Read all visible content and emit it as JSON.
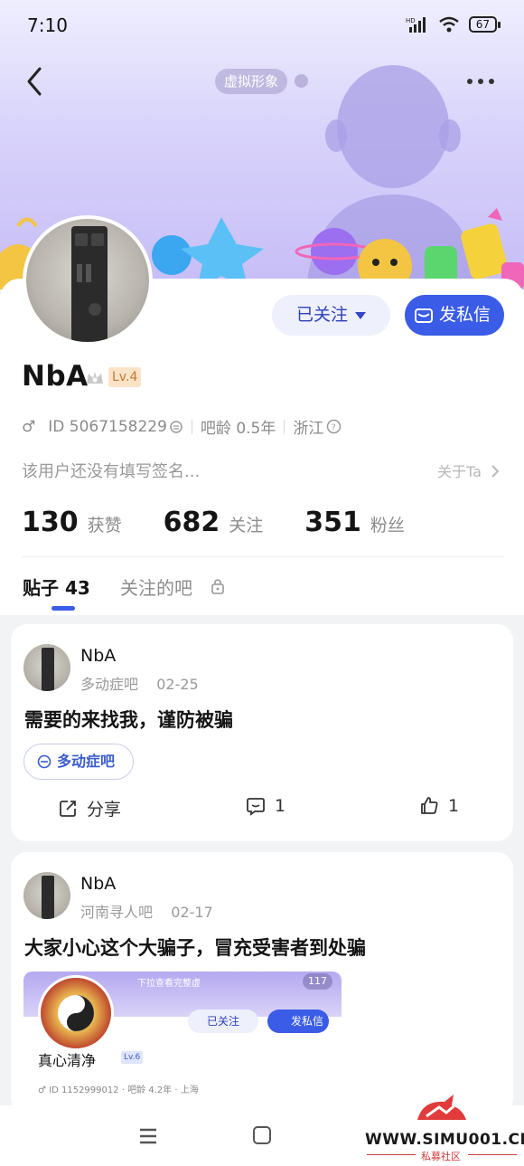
{
  "status_bar": {
    "time": "7:10",
    "network": "HD",
    "battery": "67"
  },
  "header": {
    "avatar_tag": "虚拟形象"
  },
  "profile": {
    "follow_button": "已关注",
    "message_button": "发私信",
    "username": "NbA",
    "level": "Lv.4",
    "gender": "♂",
    "user_id": "ID 5067158229",
    "account_age": "吧龄 0.5年",
    "location": "浙江",
    "signature": "该用户还没有填写签名...",
    "about_link": "关于Ta",
    "stats": [
      {
        "value": "130",
        "label": "获赞"
      },
      {
        "value": "682",
        "label": "关注"
      },
      {
        "value": "351",
        "label": "粉丝"
      }
    ]
  },
  "tabs": {
    "posts_label": "贴子",
    "posts_count": "43",
    "followed_bars": "关注的吧"
  },
  "posts": [
    {
      "author": "NbA",
      "forum": "多动症吧",
      "date": "02-25",
      "title": "需要的来找我，谨防被骗",
      "tag": "多动症吧",
      "share_label": "分享",
      "comment_count": "1",
      "like_count": "1"
    },
    {
      "author": "NbA",
      "forum": "河南寻人吧",
      "date": "02-17",
      "title": "大家小心这个大骗子，冒充受害者到处骗",
      "embedded": {
        "hint": "下拉查看完整虚",
        "count": "117",
        "follow_button": "已关注",
        "message_button": "发私信",
        "name": "真心清净",
        "level": "Lv.6",
        "gender": "♂",
        "id": "ID 1152999012",
        "age": "吧龄 4.2年",
        "location": "上海"
      }
    }
  ],
  "watermark": {
    "site": "WWW.SIMU001.CN",
    "label": "私募社区"
  }
}
